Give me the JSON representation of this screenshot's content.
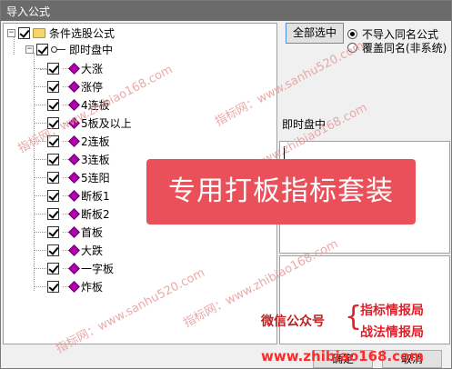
{
  "window": {
    "title": "导入公式"
  },
  "tree": {
    "root_label": "条件选股公式",
    "group_label": "即时盘中",
    "items": [
      {
        "label": "大涨"
      },
      {
        "label": "涨停"
      },
      {
        "label": "4连板"
      },
      {
        "label": "5板及以上"
      },
      {
        "label": "2连板"
      },
      {
        "label": "3连板"
      },
      {
        "label": "5连阳"
      },
      {
        "label": "断板1"
      },
      {
        "label": "断板2"
      },
      {
        "label": "首板"
      },
      {
        "label": "大跌"
      },
      {
        "label": "一字板"
      },
      {
        "label": "炸板"
      }
    ]
  },
  "buttons": {
    "select_all": "全部选中",
    "confirm": "确定",
    "cancel": "取消"
  },
  "options": {
    "no_import_same": "不导入同名公式",
    "overwrite_same": "覆盖同名(非系统)",
    "selected": "no_import_same"
  },
  "detail": {
    "name": "即时盘中"
  },
  "overlay": {
    "banner": "专用打板指标套装",
    "wechat_label": "微信公众号",
    "brace": "{",
    "brand1": "指标情报局",
    "brand2": "战法情报局",
    "website": "www.zhibiao168.com",
    "watermark1": "指标网：www.zhibiao168.com",
    "watermark2": "指标网：www.sanhu520.com",
    "watermark3": "指标网：www.zhibiao168.com",
    "watermark4": "指标网：www.sanhu520.com",
    "watermark5": "指标网：www.zhibiao168.com"
  },
  "colors": {
    "titlebar": "#6b6b6b",
    "banner": "#e9505a",
    "gem": "#b300b3",
    "brand": "#e0202a",
    "wechat": "#c02020",
    "website": "#ff2a2a"
  }
}
